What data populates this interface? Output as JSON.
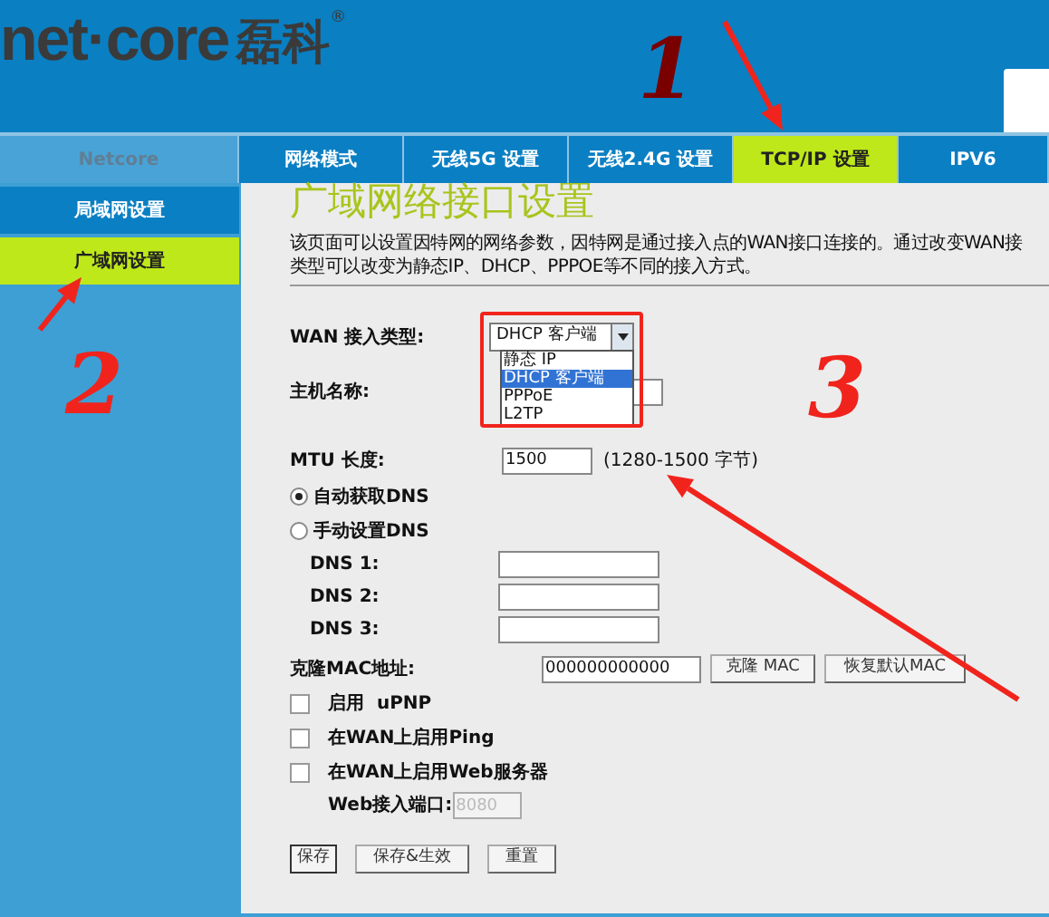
{
  "header": {
    "logo_text": "net·core",
    "logo_cn": "磊科",
    "registered": "®"
  },
  "sidebar": {
    "title": "Netcore",
    "items": [
      {
        "label": "局域网设置",
        "selected": false
      },
      {
        "label": "广域网设置",
        "selected": true
      }
    ]
  },
  "tabs": [
    {
      "label": "网络模式",
      "selected": false
    },
    {
      "label": "无线5G 设置",
      "selected": false
    },
    {
      "label": "无线2.4G 设置",
      "selected": false
    },
    {
      "label": "TCP/IP 设置",
      "selected": true
    },
    {
      "label": "IPV6",
      "selected": false
    }
  ],
  "page": {
    "title": "广域网络接口设置",
    "description": [
      "该页面可以设置因特网的网络参数，因特网是通过接入点的WAN接口连接的。通过改变WAN接",
      "类型可以改变为静态IP、DHCP、PPPOE等不同的接入方式。"
    ]
  },
  "form": {
    "wan_type": {
      "label": "WAN 接入类型:",
      "value": "DHCP 客户端",
      "options": [
        {
          "label": "静态 IP",
          "selected": false
        },
        {
          "label": "DHCP 客户端",
          "selected": true
        },
        {
          "label": "PPPoE",
          "selected": false
        },
        {
          "label": "L2TP",
          "selected": false
        }
      ]
    },
    "host_name": {
      "label": "主机名称:"
    },
    "mtu": {
      "label": "MTU 长度:",
      "value": "1500",
      "hint": "(1280-1500 字节)"
    },
    "dns_mode": [
      {
        "label": "自动获取DNS",
        "selected": true
      },
      {
        "label": "手动设置DNS",
        "selected": false
      }
    ],
    "dns": [
      {
        "label": "DNS 1:"
      },
      {
        "label": "DNS 2:"
      },
      {
        "label": "DNS 3:"
      }
    ],
    "mac": {
      "label": "克隆MAC地址:",
      "value": "000000000000",
      "buttons": [
        "克隆 MAC",
        "恢复默认MAC"
      ]
    },
    "options": [
      {
        "label": "启用  uPNP",
        "checked": false
      },
      {
        "label": "在WAN上启用Ping",
        "checked": false
      },
      {
        "label": "在WAN上启用Web服务器",
        "checked": false
      }
    ],
    "web_port": {
      "label": "Web接入端口:",
      "value": "8080",
      "disabled": true
    },
    "buttons": [
      "保存",
      "保存&生效",
      "重置"
    ]
  },
  "annotations": [
    "1",
    "2",
    "3"
  ]
}
